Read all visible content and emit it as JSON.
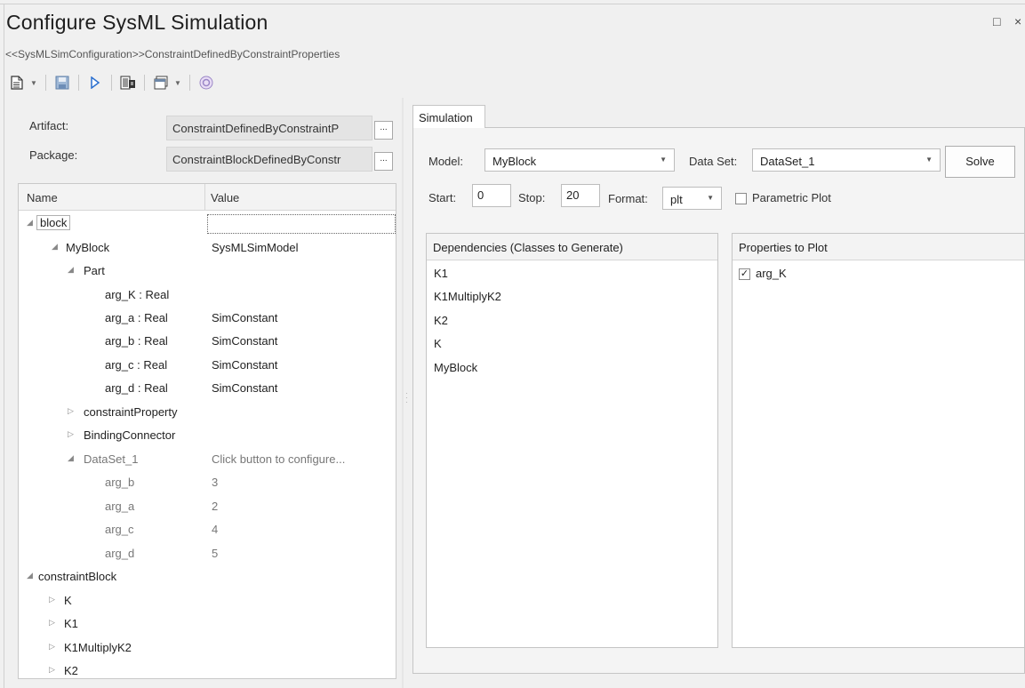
{
  "window": {
    "title": "Configure SysML Simulation",
    "subtitle": "<<SysMLSimConfiguration>>ConstraintDefinedByConstraintProperties",
    "maximize_glyph": "□",
    "close_glyph": "×"
  },
  "toolbar": {
    "items": [
      "new-document-icon",
      "save-icon",
      "run-icon",
      "generate-icon",
      "window-icon",
      "help-icon"
    ]
  },
  "fields": {
    "artifact_label": "Artifact:",
    "artifact_value": "ConstraintDefinedByConstraintP",
    "package_label": "Package:",
    "package_value": "ConstraintBlockDefinedByConstr",
    "browse": "..."
  },
  "tree": {
    "col_name": "Name",
    "col_value": "Value",
    "rows": [
      {
        "name": "block",
        "value": ""
      },
      {
        "name": "MyBlock",
        "value": "SysMLSimModel"
      },
      {
        "name": "Part",
        "value": ""
      },
      {
        "name": "arg_K : Real",
        "value": ""
      },
      {
        "name": "arg_a : Real",
        "value": "SimConstant"
      },
      {
        "name": "arg_b : Real",
        "value": "SimConstant"
      },
      {
        "name": "arg_c : Real",
        "value": "SimConstant"
      },
      {
        "name": "arg_d : Real",
        "value": "SimConstant"
      },
      {
        "name": "constraintProperty",
        "value": ""
      },
      {
        "name": "BindingConnector",
        "value": ""
      },
      {
        "name": "DataSet_1",
        "value": "Click button to configure..."
      },
      {
        "name": "arg_b",
        "value": "3"
      },
      {
        "name": "arg_a",
        "value": "2"
      },
      {
        "name": "arg_c",
        "value": "4"
      },
      {
        "name": "arg_d",
        "value": "5"
      },
      {
        "name": "constraintBlock",
        "value": ""
      },
      {
        "name": "K",
        "value": ""
      },
      {
        "name": "K1",
        "value": ""
      },
      {
        "name": "K1MultiplyK2",
        "value": ""
      },
      {
        "name": "K2",
        "value": ""
      }
    ]
  },
  "simulation": {
    "tab_label": "Simulation",
    "model_label": "Model:",
    "model_value": "MyBlock",
    "dataset_label": "Data Set:",
    "dataset_value": "DataSet_1",
    "solve_label": "Solve",
    "start_label": "Start:",
    "start_value": "0",
    "stop_label": "Stop:",
    "stop_value": "20",
    "format_label": "Format:",
    "format_value": "plt",
    "parametric_label": "Parametric Plot",
    "dependencies_header": "Dependencies (Classes to Generate)",
    "dependencies": [
      "K1",
      "K1MultiplyK2",
      "K2",
      "K",
      "MyBlock"
    ],
    "properties_header": "Properties to Plot",
    "properties": [
      {
        "name": "arg_K",
        "checked": "true"
      }
    ]
  },
  "glyphs": {
    "expanded": "◢",
    "collapsed": "▷",
    "caret": "▼",
    "check": "✓"
  },
  "colors": {
    "accent": "#2a6fcf",
    "disabled_gray": "#777777"
  }
}
